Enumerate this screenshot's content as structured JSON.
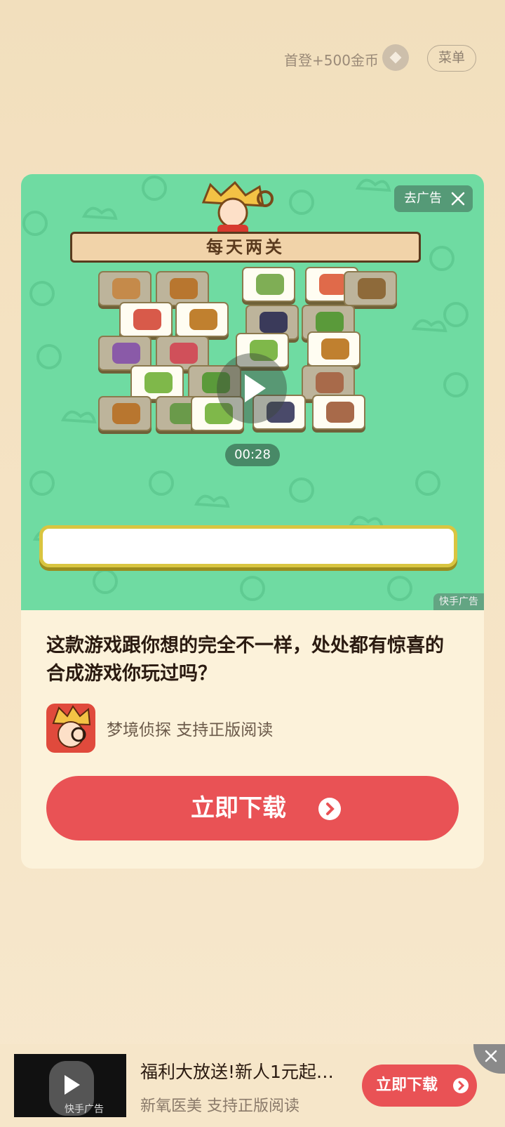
{
  "topbar": {
    "bonus_text": "首登+500金币",
    "menu_label": "菜单"
  },
  "ad": {
    "skip_label": "去广告",
    "banner_text": "每天两关",
    "timer": "00:28",
    "watermark": "快手广告",
    "description": "这款游戏跟你想的完全不一样，处处都有惊喜的合成游戏你玩过吗？",
    "app_name": "梦境侦探  支持正版阅读",
    "download_label": "立即下载"
  },
  "bottom_ad": {
    "title": "福利大放送!新人1元起…",
    "app_name": "新氧医美  支持正版阅读",
    "download_label": "立即下载",
    "thumb_watermark": "快手广告"
  },
  "colors": {
    "accent_red": "#e95255",
    "media_green": "#6fdba2",
    "card_bg": "#fcf2da"
  }
}
